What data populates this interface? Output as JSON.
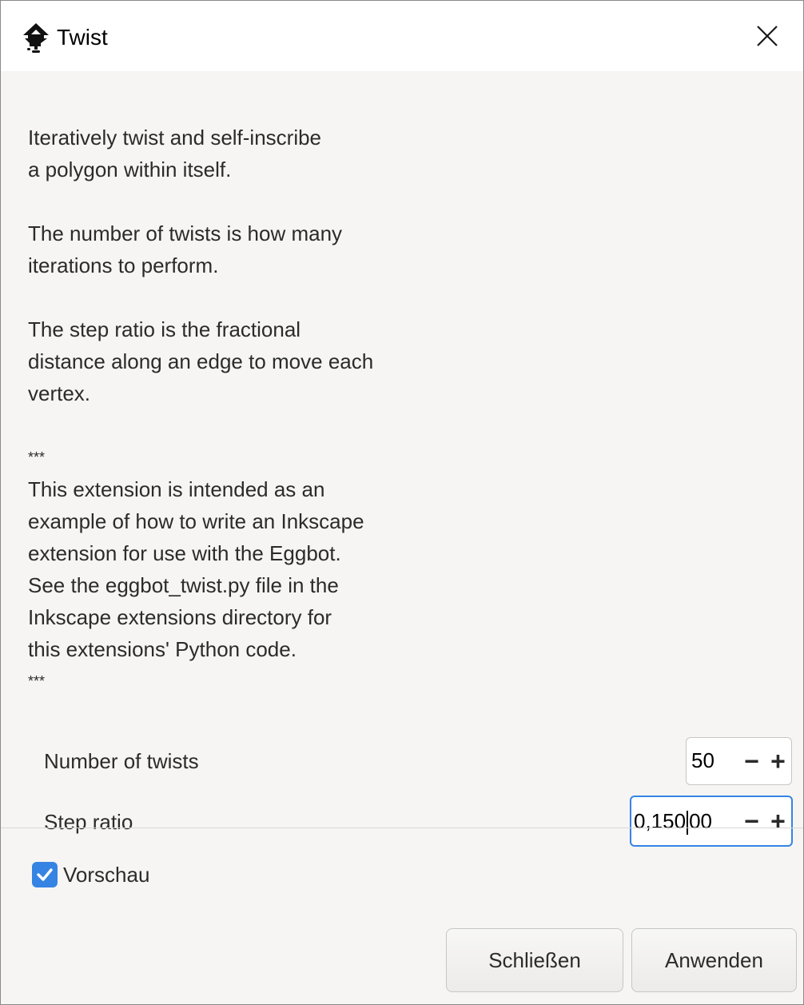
{
  "window": {
    "title": "Twist",
    "app_icon": "inkscape-logo-icon",
    "close_icon": "close-icon"
  },
  "description": {
    "lines": [
      "Iteratively twist and self-inscribe",
      "a polygon within itself.",
      "",
      "The number of twists is how many",
      "iterations to perform.",
      "",
      "The step ratio is the fractional",
      "distance along an edge to move each",
      "vertex.",
      "",
      "***",
      "This extension is intended as an",
      "example of how to write an Inkscape",
      "extension for use with the Eggbot.",
      "See the eggbot_twist.py file in the",
      "Inkscape extensions directory for",
      "this extensions' Python code.",
      "***"
    ]
  },
  "params": {
    "twists": {
      "label": "Number of twists",
      "value": "50",
      "decrement": "−",
      "increment": "+"
    },
    "step_ratio": {
      "label": "Step ratio",
      "value_before_caret": "0,150",
      "value_after_caret": "00",
      "decrement": "−",
      "increment": "+"
    }
  },
  "preview": {
    "label": "Vorschau",
    "checked": true
  },
  "buttons": {
    "close": "Schließen",
    "apply": "Anwenden"
  },
  "colors": {
    "accent": "#3584e4",
    "background": "#f6f5f4"
  }
}
